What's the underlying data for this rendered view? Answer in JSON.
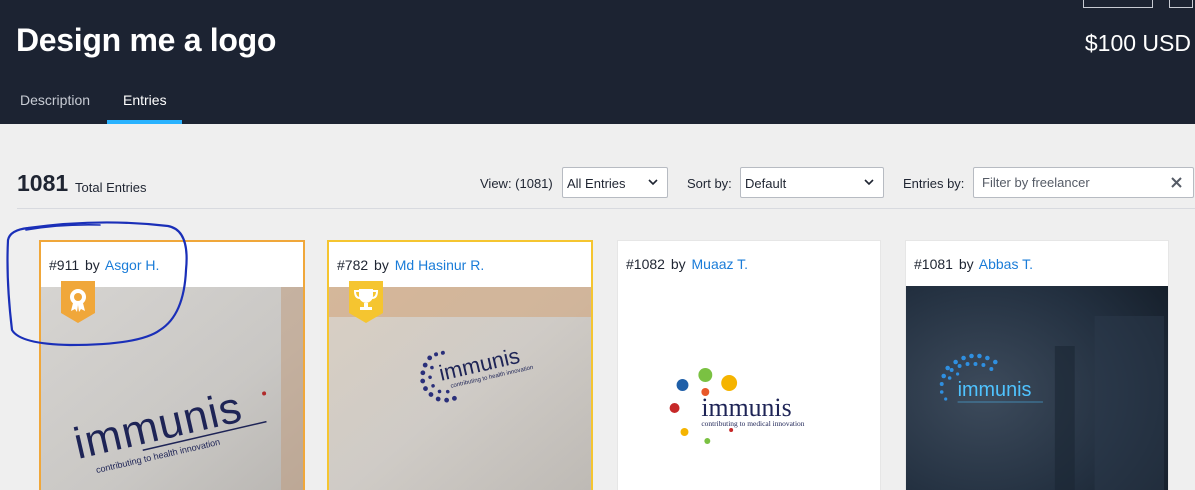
{
  "header": {
    "title": "Design me a logo",
    "price": "$100 USD",
    "tabs": [
      {
        "label": "Description",
        "active": false
      },
      {
        "label": "Entries",
        "active": true
      }
    ]
  },
  "toolbar": {
    "total_count": "1081",
    "total_label": "Total Entries",
    "view_label": "View: (1081)",
    "view_selected": "All Entries",
    "sort_label": "Sort by:",
    "sort_selected": "Default",
    "entries_by_label": "Entries by:",
    "filter_placeholder": "Filter by freelancer"
  },
  "entries": [
    {
      "number": "#911",
      "by": "by",
      "freelancer": "Asgor H.",
      "badge": "award-ribbon-icon",
      "badge_color": "#f0a73a",
      "logo_text": "immunis",
      "logo_tagline": "contributing to health innovation"
    },
    {
      "number": "#782",
      "by": "by",
      "freelancer": "Md Hasinur R.",
      "badge": "trophy-icon",
      "badge_color": "#f5c530",
      "logo_text": "immunis",
      "logo_tagline": "contributing to health innovation"
    },
    {
      "number": "#1082",
      "by": "by",
      "freelancer": "Muaaz T.",
      "logo_text": "immunis",
      "logo_tagline": "contributing to medical innovation"
    },
    {
      "number": "#1081",
      "by": "by",
      "freelancer": "Abbas T.",
      "logo_text": "immunis"
    }
  ],
  "colors": {
    "header_bg": "#1c2332",
    "accent": "#29b2fe",
    "link": "#1a7cd8",
    "award_gold": "#f0a73a",
    "annotation": "#1a2fb8"
  }
}
